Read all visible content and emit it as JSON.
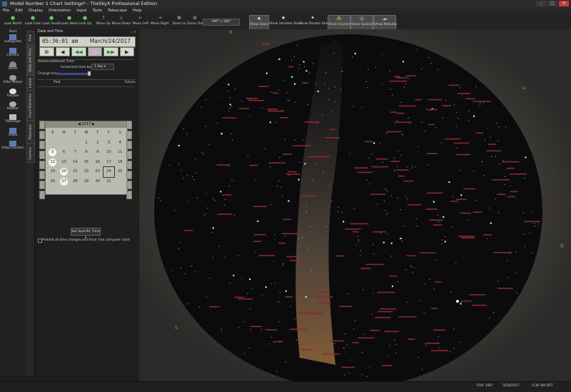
{
  "window": {
    "title": "Model Number 1 Chart Settings* - TheSkyX Professional Edition",
    "controls": [
      "–",
      "▢",
      "✕"
    ]
  },
  "menu": [
    "File",
    "Edit",
    "Display",
    "Orientation",
    "Input",
    "Tools",
    "Telescope",
    "Help"
  ],
  "toolbar": {
    "look_north": "Look North",
    "look_east": "Look East",
    "look_south": "Look South",
    "look_west": "Look West",
    "look_up": "Look Up",
    "move_up": "Move Up",
    "move_down": "Move Down",
    "move_left": "Move Left",
    "move_right": "Move Right",
    "zoom_in": "Zoom In",
    "zoom_out": "Zoom Out",
    "fov_value": "180° x 180°",
    "show_stars": "Show Stars",
    "show_variable_stars": "Show Variable Stars",
    "show_double_stars": "Show Double Stars",
    "show_clusters": "Show Clusters",
    "show_galaxies": "Show Galaxies",
    "show_nebulas": "Show Nebulas"
  },
  "left_sidebar": {
    "header": "Start",
    "items": [
      "Autoguider",
      "Camera",
      "Dome",
      "Filter Wheel",
      "Focuser",
      "Rotator",
      "Telescope",
      "Video",
      "Video (Guider)"
    ]
  },
  "vertical_tabs": [
    "Find",
    "Date and Time",
    "Labels",
    "Chart Elements",
    "Telescope",
    "Camera"
  ],
  "date_time_panel": {
    "header": "Date and Time",
    "time": "05:36:01 am",
    "date": "March/24/2017",
    "advance_retreat_label": "Advance/Retreat Time",
    "increment_label": "Increment time by:",
    "increment_value": "1 day",
    "change_time_label": "Change time:",
    "past_label": "Past",
    "future_label": "Future",
    "set_specific_time": "Set Specific Time",
    "prohibit_label": "Prohibit all time changes and force 'Use computer clock'"
  },
  "calendar": {
    "year": "2017",
    "month": "Mar",
    "headers": [
      "S",
      "M",
      "T",
      "W",
      "T",
      "F",
      "S"
    ],
    "weeks": [
      [
        "",
        "",
        "",
        "1",
        "2",
        "3",
        "4"
      ],
      [
        "5",
        "6",
        "7",
        "8",
        "9",
        "10",
        "11"
      ],
      [
        "12",
        "13",
        "14",
        "15",
        "16",
        "17",
        "18"
      ],
      [
        "19",
        "20",
        "21",
        "22",
        "23",
        "24",
        "25"
      ],
      [
        "26",
        "27",
        "28",
        "29",
        "30",
        "31",
        ""
      ],
      [
        "",
        "",
        "",
        "",
        "",
        "",
        ""
      ]
    ],
    "selected_day": "24"
  },
  "sky_labels": [
    "N",
    "E",
    "S",
    "W",
    "M 31",
    "Jupiter"
  ],
  "status_bar": {
    "fov": "FOV: 180°",
    "date": "3/24/2017",
    "time": "5:36 AM DST"
  }
}
